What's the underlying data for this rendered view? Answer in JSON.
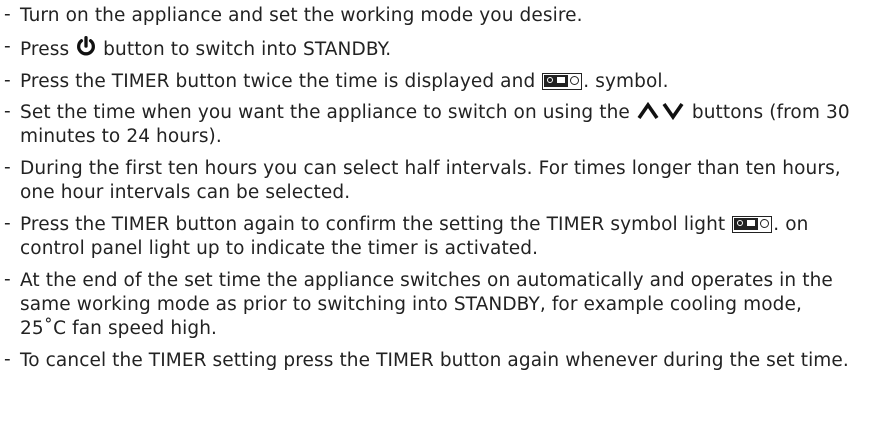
{
  "items": [
    {
      "dash": "-",
      "text": "Turn on the appliance and set the working mode you desire."
    },
    {
      "dash": "-",
      "before": "Press",
      "after": "button to switch into STANDBY."
    },
    {
      "dash": "-",
      "before": "Press the TIMER button twice the time is displayed and",
      "after": ". symbol."
    },
    {
      "dash": "-",
      "before": "Set the time when you want the appliance to switch on using the",
      "after": "buttons (from 30 minutes to 24 hours)."
    },
    {
      "dash": "-",
      "text": "During the first ten hours you can select half intervals. For times longer than ten hours, one hour intervals can be selected."
    },
    {
      "dash": "-",
      "before": "Press the TIMER button again to confirm the setting the TIMER symbol light",
      "after": ". on control panel light up to indicate the timer is activated."
    },
    {
      "dash": "-",
      "text": "At the end of the set time the appliance switches on automatically and operates in the same working mode as prior to switching into STANDBY, for example cooling mode, 25˚C fan speed high."
    },
    {
      "dash": "-",
      "text": "To cancel the TIMER setting press the TIMER button again whenever during the set time."
    }
  ],
  "icons": {
    "power": "power-icon",
    "up": "up-arrow-icon",
    "down": "down-arrow-icon",
    "timer": "timer-symbol-icon"
  },
  "colors": {
    "text": "#222222"
  }
}
